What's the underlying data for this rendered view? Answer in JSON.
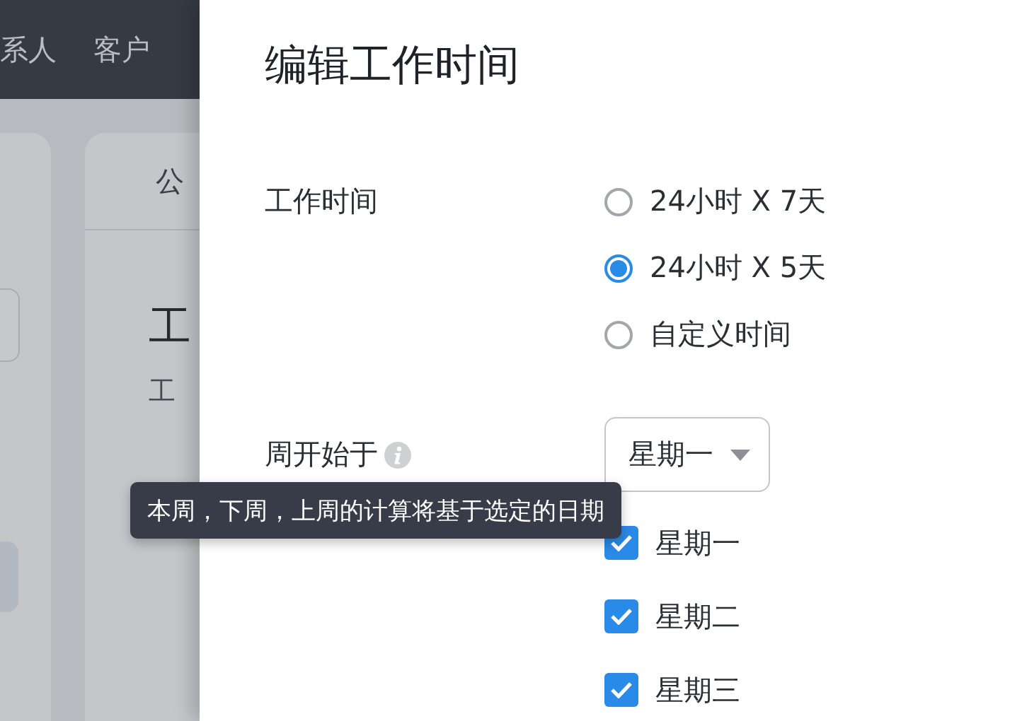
{
  "background": {
    "nav_items": [
      "系人",
      "客户"
    ],
    "card_tab": "公",
    "card_heading": "工",
    "card_text": "工"
  },
  "drawer": {
    "title": "编辑工作时间",
    "fields": [
      {
        "kind": "radio",
        "label": "工作时间",
        "options": [
          {
            "label": "24小时 X 7天",
            "selected": false
          },
          {
            "label": "24小时 X 5天",
            "selected": true
          },
          {
            "label": "自定义时间",
            "selected": false
          }
        ]
      },
      {
        "kind": "select",
        "label": "周开始于",
        "value": "星期一"
      },
      {
        "kind": "checkbox",
        "options": [
          {
            "label": "星期一",
            "checked": true
          },
          {
            "label": "星期二",
            "checked": true
          },
          {
            "label": "星期三",
            "checked": true
          }
        ]
      }
    ]
  },
  "tooltip": {
    "text": "本周，下周，上周的计算将基于选定的日期"
  }
}
